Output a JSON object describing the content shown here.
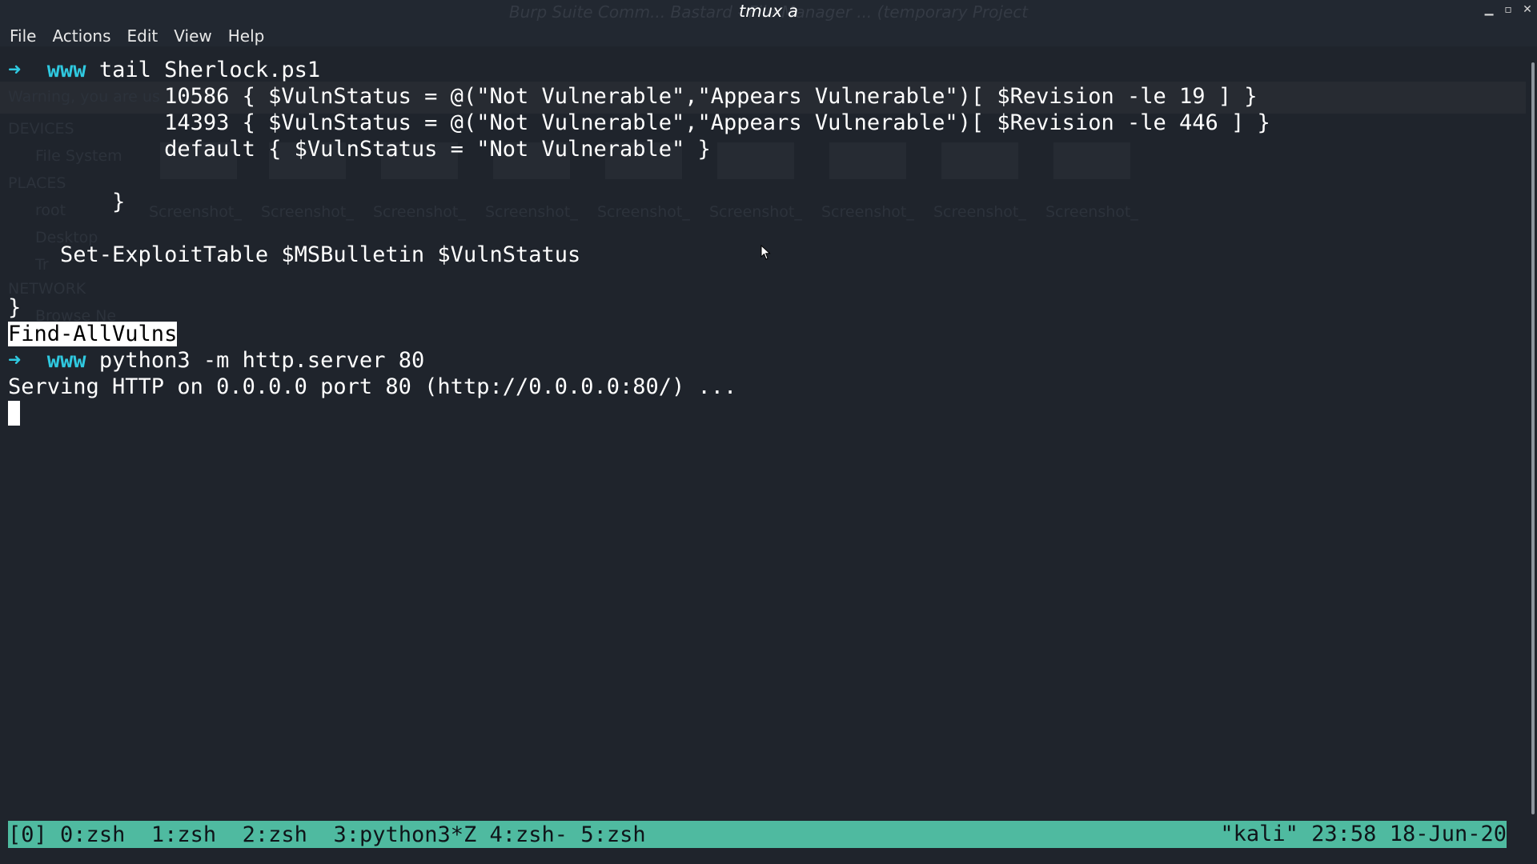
{
  "window": {
    "title": "tmux a",
    "background_title": "Burp Suite Comm... Bastard - File Manager ... (temporary Project",
    "controls": [
      "minimize",
      "maximize",
      "close"
    ]
  },
  "menu": {
    "items": [
      "File",
      "Actions",
      "Edit",
      "View",
      "Help"
    ]
  },
  "terminal": {
    "prompt_arrow": "➜",
    "prompt_dir": "www",
    "lines": {
      "cmd1": "tail Sherlock.ps1",
      "l1": "            10586 { $VulnStatus = @(\"Not Vulnerable\",\"Appears Vulnerable\")[ $Revision -le 19 ] }",
      "l2": "            14393 { $VulnStatus = @(\"Not Vulnerable\",\"Appears Vulnerable\")[ $Revision -le 446 ] }",
      "l3": "            default { $VulnStatus = \"Not Vulnerable\" }",
      "l4": "        }",
      "l5": "    Set-ExploitTable $MSBulletin $VulnStatus",
      "l6": "}",
      "highlighted": "Find-AllVulns",
      "cmd2": "python3 -m http.server 80",
      "serving": "Serving HTTP on 0.0.0.0 port 80 (http://0.0.0.0:80/) ..."
    },
    "ghost_text": {
      "warning": "Warning, you are us",
      "devices": "DEVICES",
      "file_system": "File System",
      "places": "PLACES",
      "root": "root",
      "desktop": "Desktop",
      "trash": "Tr",
      "network": "NETWORK",
      "browse": "Browse Ne",
      "thumbs": [
        "Screenshot_",
        "Screenshot_",
        "Screenshot_",
        "Screenshot_",
        "Screenshot_",
        "Screenshot_",
        "Screenshot_",
        "Screenshot_",
        "Screenshot_"
      ]
    }
  },
  "status": {
    "session": "[0]",
    "windows": [
      "0:zsh",
      "1:zsh",
      "2:zsh",
      "3:python3*Z",
      "4:zsh-",
      "5:zsh"
    ],
    "right": "\"kali\" 23:58 18-Jun-20"
  },
  "colors": {
    "background": "#1f242c",
    "prompt": "#2fc9e0",
    "status_bar": "#4fbaa0"
  }
}
